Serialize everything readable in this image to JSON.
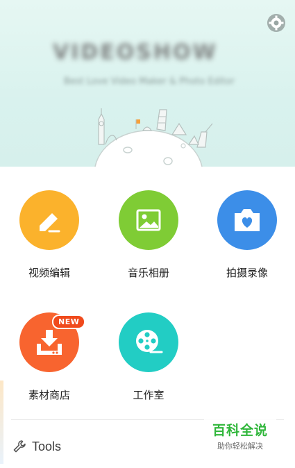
{
  "header": {
    "brand_text": "VIDEOSHOW",
    "slogan_text": "Best Love Video Maker & Photo Editor",
    "settings_icon": "gear-icon"
  },
  "features": [
    {
      "label": "视频编辑",
      "icon": "pencil-icon",
      "color": "#fbb22c"
    },
    {
      "label": "音乐相册",
      "icon": "image-icon",
      "color": "#7fcc35"
    },
    {
      "label": "拍摄录像",
      "icon": "camera-heart-icon",
      "color": "#3c8ee8"
    },
    {
      "label": "素材商店",
      "icon": "download-icon",
      "color": "#f8642f",
      "badge": "NEW"
    },
    {
      "label": "工作室",
      "icon": "film-reel-icon",
      "color": "#22cdc4"
    }
  ],
  "tools": {
    "label": "Tools",
    "icon": "wrench-icon"
  },
  "watermark": {
    "title": "百科全说",
    "subtitle": "助你轻松解决"
  }
}
